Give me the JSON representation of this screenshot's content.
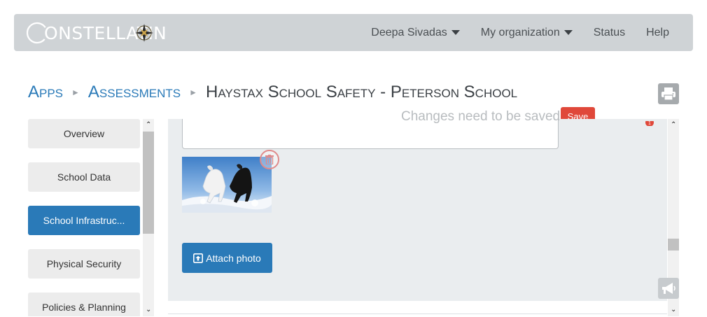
{
  "header": {
    "logo_text": "CONSTELLATION",
    "nav": [
      {
        "label": "Deepa Sivadas",
        "dropdown": true
      },
      {
        "label": "My organization",
        "dropdown": true
      },
      {
        "label": "Status",
        "dropdown": false
      },
      {
        "label": "Help",
        "dropdown": false
      }
    ]
  },
  "breadcrumb": {
    "apps": "Apps",
    "assessments": "Assessments",
    "current": "Haystax School Safety - Peterson School"
  },
  "sidebar": {
    "items": [
      {
        "label": "Overview",
        "active": false
      },
      {
        "label": "School Data",
        "active": false
      },
      {
        "label": "School Infrastruc...",
        "active": true
      },
      {
        "label": "Physical Security",
        "active": false
      },
      {
        "label": "Policies & Planning",
        "active": false
      }
    ]
  },
  "status": {
    "changes_text": "Changes need to be saved",
    "save_label": "Save",
    "badge_count": "1"
  },
  "panel": {
    "attach_label": "Attach photo"
  },
  "colors": {
    "accent": "#2a7ab8",
    "topbar": "#cfd3d6",
    "panel": "#eaedef",
    "danger": "#e0483a"
  }
}
